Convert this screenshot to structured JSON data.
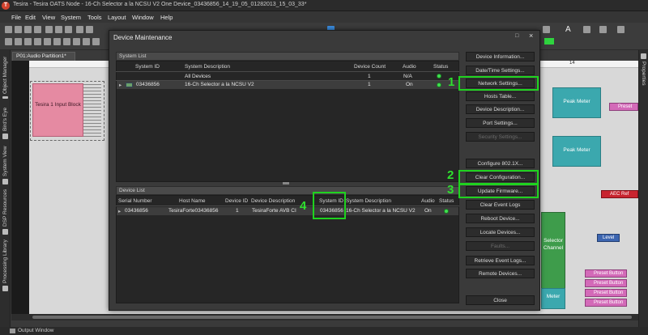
{
  "window": {
    "title": "Tesira - Tesira OATS Node - 16-Ch Selector a la NCSU V2 One Device_03436856_14_19_05_01282013_15_03_33*",
    "app_icon_letter": "T"
  },
  "menu": [
    "File",
    "Edit",
    "View",
    "System",
    "Tools",
    "Layout",
    "Window",
    "Help"
  ],
  "left_dock_tabs": [
    "Object Manager",
    "Bird's Eye",
    "System View",
    "DSP Resources",
    "Processing Library"
  ],
  "right_dock_tabs": [
    "Properties"
  ],
  "doc_tab": "P01:Audio Partition1*",
  "status_bar": {
    "output_window": "Output Window"
  },
  "canvas": {
    "ruler_mark": "14",
    "input_block": "Tesira 1 Input Block",
    "peak_meter_1": "Peak Meter",
    "peak_meter_2": "Peak Meter",
    "selector": "Selector",
    "selector_line2": "Channel",
    "level": "Level",
    "meter_text": "Meter",
    "preset_tag_top": "Preset",
    "aec_ref": "AEC Ref",
    "preset_buttons": [
      "Preset Button",
      "Preset Button",
      "Preset Button",
      "Preset Button"
    ]
  },
  "dialog": {
    "title": "Device Maintenance",
    "system_list": {
      "header": "System List",
      "columns": [
        "System ID",
        "System Description",
        "Device Count",
        "Audio",
        "Status"
      ],
      "rows": [
        {
          "id": "",
          "description": "All Devices",
          "count": "1",
          "audio": "N/A"
        },
        {
          "id": "03436856",
          "description": "16-Ch Selector a la NCSU V2",
          "count": "1",
          "audio": "On"
        }
      ]
    },
    "device_list": {
      "header": "Device List",
      "columns": [
        "Serial Number",
        "Host Name",
        "Device ID",
        "Device Description",
        "System ID",
        "System Description",
        "Audio",
        "Status"
      ],
      "rows": [
        {
          "serial": "03436856",
          "host": "TesiraForte03436856",
          "device_id": "1",
          "device_desc": "TesiraForte AVB CI",
          "system_id": "03436856",
          "system_desc": "16-Ch Selector a la NCSU V2",
          "audio": "On"
        }
      ]
    },
    "buttons": [
      {
        "label": "Device Information...",
        "enabled": true
      },
      {
        "label": "Date/Time Settings...",
        "enabled": true
      },
      {
        "label": "Network Settings...",
        "enabled": true
      },
      {
        "label": "Hosts Table...",
        "enabled": true
      },
      {
        "label": "Device Description...",
        "enabled": true
      },
      {
        "label": "Port Settings...",
        "enabled": true
      },
      {
        "label": "Security Settings...",
        "enabled": false
      },
      {
        "label": "Configure 802.1X...",
        "enabled": true
      },
      {
        "label": "Clear Configuration...",
        "enabled": true
      },
      {
        "label": "Update Firmware...",
        "enabled": true
      },
      {
        "label": "Clear Event Logs",
        "enabled": true
      },
      {
        "label": "Reboot Device...",
        "enabled": true
      },
      {
        "label": "Locate Devices...",
        "enabled": true
      },
      {
        "label": "Faults...",
        "enabled": false
      },
      {
        "label": "Retrieve Event Logs...",
        "enabled": true
      },
      {
        "label": "Remote Devices...",
        "enabled": true
      },
      {
        "label": "Close",
        "enabled": true
      }
    ],
    "callouts": [
      "1",
      "2",
      "3",
      "4"
    ]
  },
  "colors": {
    "callout": "#1fd21f",
    "status_ok": "#3fe04f",
    "input_block": "#e58aa2",
    "peak_meter": "#3ba8ae"
  }
}
